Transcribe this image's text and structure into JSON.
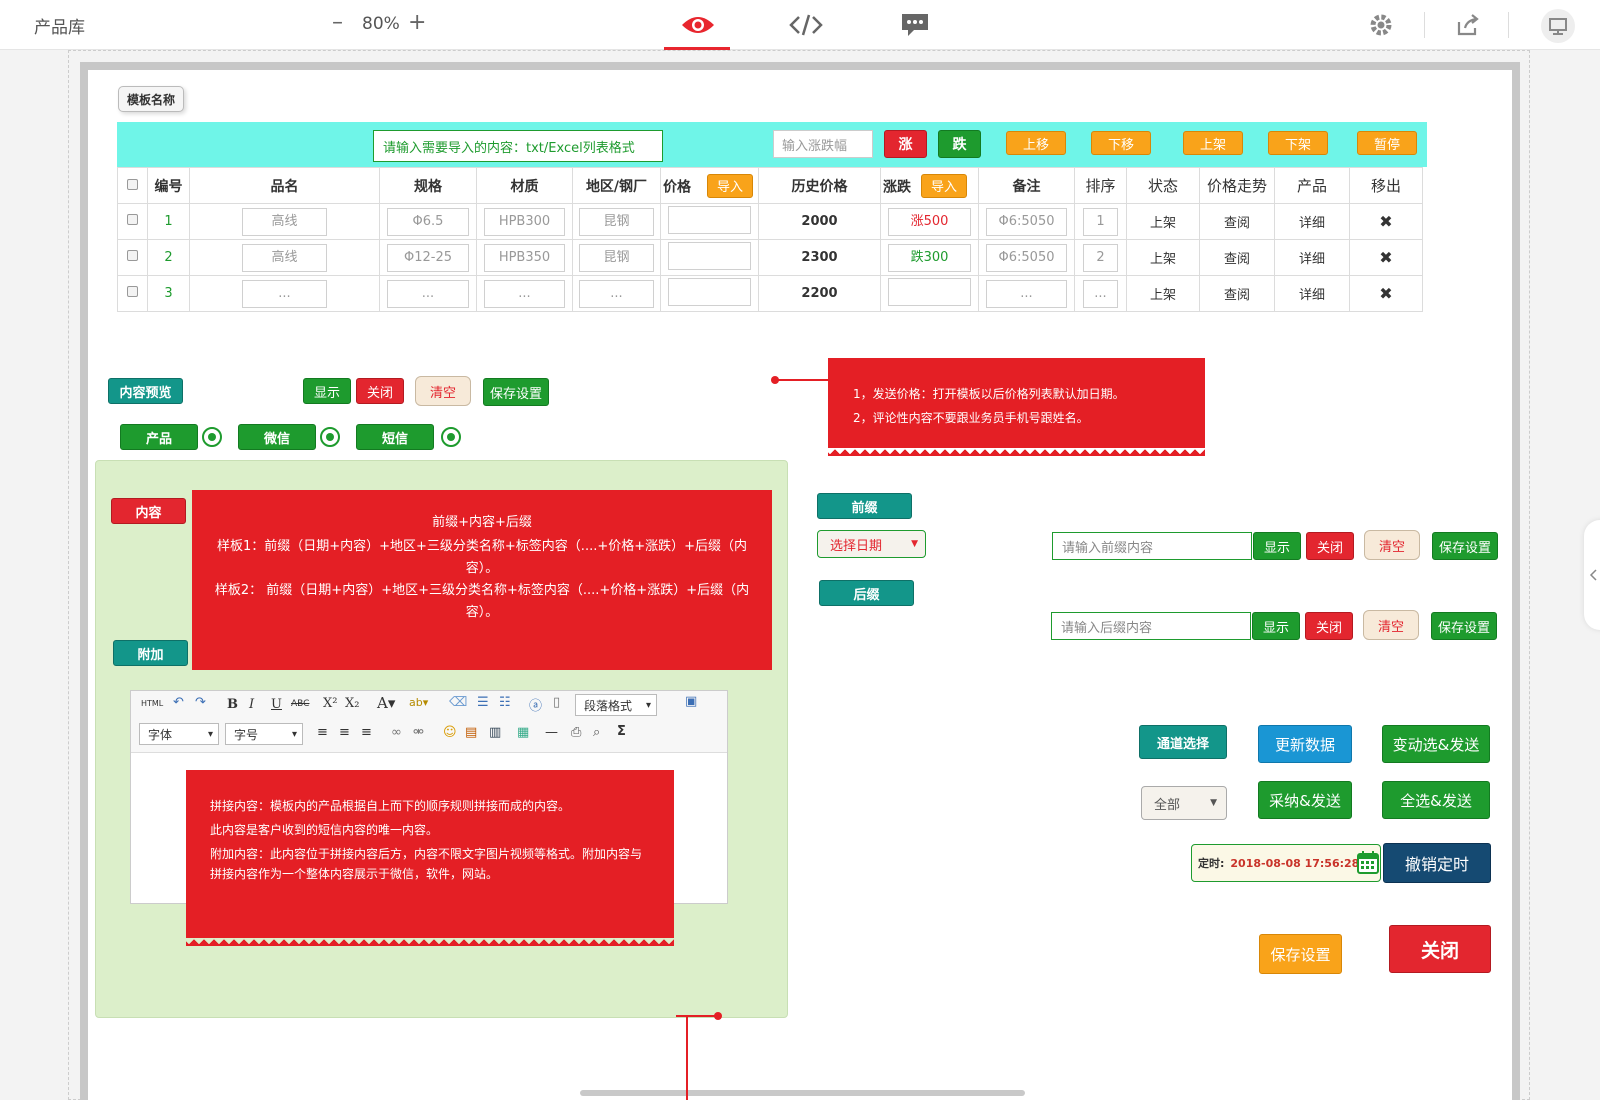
{
  "topbar": {
    "title": "产品库",
    "zoom": "80%",
    "zoom_minus": "–",
    "zoom_plus": "+"
  },
  "template_name": "模板名称",
  "import": {
    "placeholder": "请输入需要导入的内容：txt/Excel列表格式",
    "change_placeholder": "输入涨跌幅",
    "buttons": {
      "rise": "涨",
      "fall": "跌",
      "move_up": "上移",
      "move_down": "下移",
      "list": "上架",
      "delist": "下架",
      "pause": "暂停"
    }
  },
  "table": {
    "headers": {
      "id": "编号",
      "name": "品名",
      "spec": "规格",
      "material": "材质",
      "region": "地区/钢厂",
      "price": "价格",
      "price_import": "导入",
      "history": "历史价格",
      "change": "涨跌",
      "change_import": "导入",
      "remark": "备注",
      "order": "排序",
      "status": "状态",
      "trend": "价格走势",
      "product": "产品",
      "remove": "移出"
    },
    "rows": [
      {
        "id": "1",
        "name": "高线",
        "spec": "Φ6.5",
        "material": "HPB300",
        "region": "昆钢",
        "history": "2000",
        "change": "涨500",
        "remark": "Φ6:5050",
        "order": "1",
        "status": "上架",
        "trend": "查阅",
        "product": "详细",
        "remove": "✖"
      },
      {
        "id": "2",
        "name": "高线",
        "spec": "Φ12-25",
        "material": "HPB350",
        "region": "昆钢",
        "history": "2300",
        "change": "跌300",
        "remark": "Φ6:5050",
        "order": "2",
        "status": "上架",
        "trend": "查阅",
        "product": "详细",
        "remove": "✖"
      },
      {
        "id": "3",
        "name": "...",
        "spec": "...",
        "material": "...",
        "region": "...",
        "history": "2200",
        "change": "",
        "remark": "...",
        "order": "...",
        "status": "上架",
        "trend": "查阅",
        "product": "详细",
        "remove": "✖"
      }
    ]
  },
  "preview": {
    "label": "内容预览",
    "show": "显示",
    "close": "关闭",
    "clear": "清空",
    "save": "保存设置"
  },
  "channels": {
    "product": "产品",
    "wechat": "微信",
    "sms": "短信"
  },
  "note_top": {
    "line1": "1，发送价格：打开模板以后价格列表默认加日期。",
    "line2": "2，评论性内容不要跟业务员手机号跟姓名。"
  },
  "content": {
    "label": "内容",
    "attach": "附加",
    "title": "前缀+内容+后缀",
    "sample1": "样板1：前缀（日期+内容）+地区+三级分类名称+标签内容（....+价格+涨跌）+后缀（内容）。",
    "sample2": "样板2：  前缀（日期+内容）+地区+三级分类名称+标签内容（....+价格+涨跌）+后缀（内容）。"
  },
  "editor": {
    "font": "字体",
    "size": "字号",
    "paragraph": "段落格式",
    "note": {
      "line1": "拼接内容：模板内的产品根据自上而下的顺序规则拼接而成的内容。",
      "line2": "此内容是客户收到的短信内容的唯一内容。",
      "line3": "附加内容：此内容位于拼接内容后方，内容不限文字图片视频等格式。附加内容与拼接内容作为一个整体内容展示于微信，软件，网站。"
    }
  },
  "prefix": {
    "label": "前缀",
    "date_select": "选择日期",
    "placeholder": "请输入前缀内容",
    "show": "显示",
    "close": "关闭",
    "clear": "清空",
    "save": "保存设置"
  },
  "suffix": {
    "label": "后缀",
    "placeholder": "请输入后缀内容",
    "show": "显示",
    "close": "关闭",
    "clear": "清空",
    "save": "保存设置"
  },
  "send": {
    "channel_select": "通道选择",
    "update": "更新数据",
    "change_send": "变动选&发送",
    "filter": "全部",
    "adopt_send": "采纳&发送",
    "all_send": "全选&发送",
    "timer_label": "定时:",
    "timer_value": "2018-08-08  17:56:28",
    "cancel_timer": "撤销定时",
    "save": "保存设置",
    "close": "关闭"
  },
  "colors": {
    "accent_red": "#e3262f",
    "green": "#1e9b2e",
    "orange": "#f9a31a",
    "teal": "#13968a",
    "cyan_bar": "#6ff5e8"
  }
}
